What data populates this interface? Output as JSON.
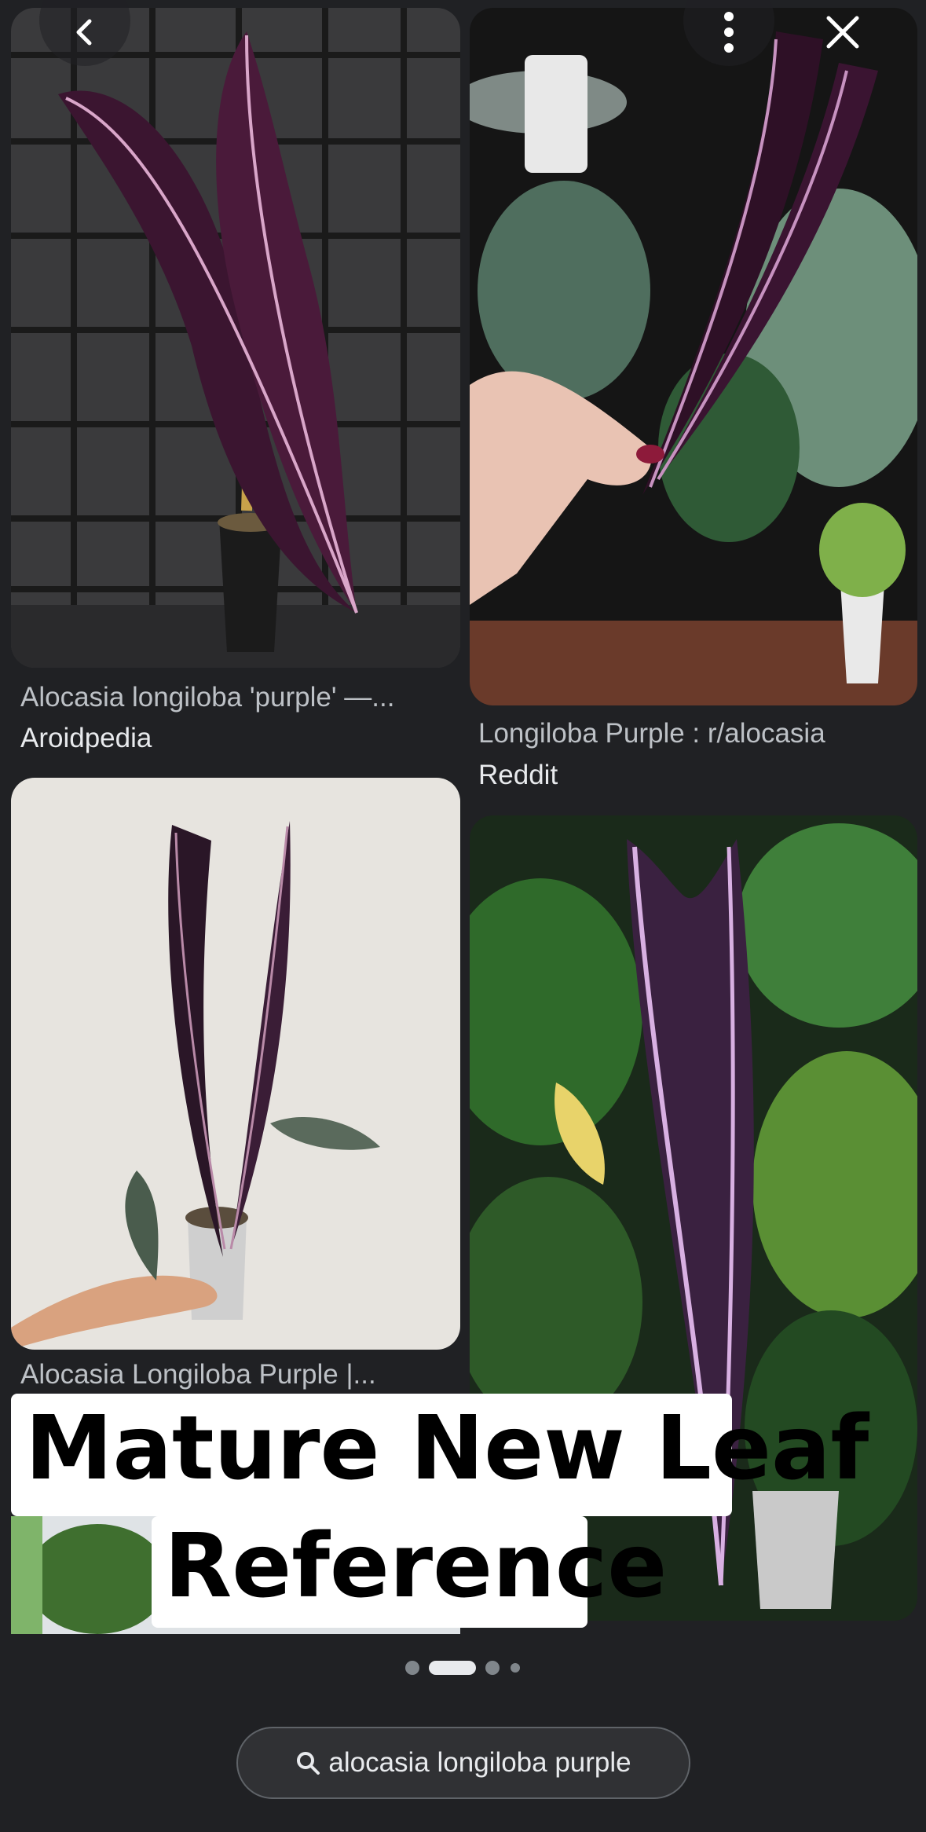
{
  "top_bar": {
    "back_icon": "chevron-left-icon",
    "menu_icon": "more-vert-icon",
    "close_icon": "close-icon"
  },
  "results": [
    {
      "caption": "Alocasia longiloba 'purple' —...",
      "source": "Aroidpedia"
    },
    {
      "caption": "Longiloba Purple : r/alocasia",
      "source": "Reddit"
    },
    {
      "caption": "Alocasia Longiloba Purple |...",
      "source": ""
    },
    {
      "caption": "",
      "source": ""
    }
  ],
  "overlay": {
    "line1": "Mature New Leaf",
    "line2": "Reference"
  },
  "pagination": {
    "count": 4,
    "active_index": 1
  },
  "search": {
    "icon": "search-icon",
    "query": "alocasia longiloba purple"
  },
  "colors": {
    "background": "#202124",
    "leaf_purple": "#3b1530",
    "vein": "#d9a6c9",
    "pill_border": "#5f6368"
  }
}
